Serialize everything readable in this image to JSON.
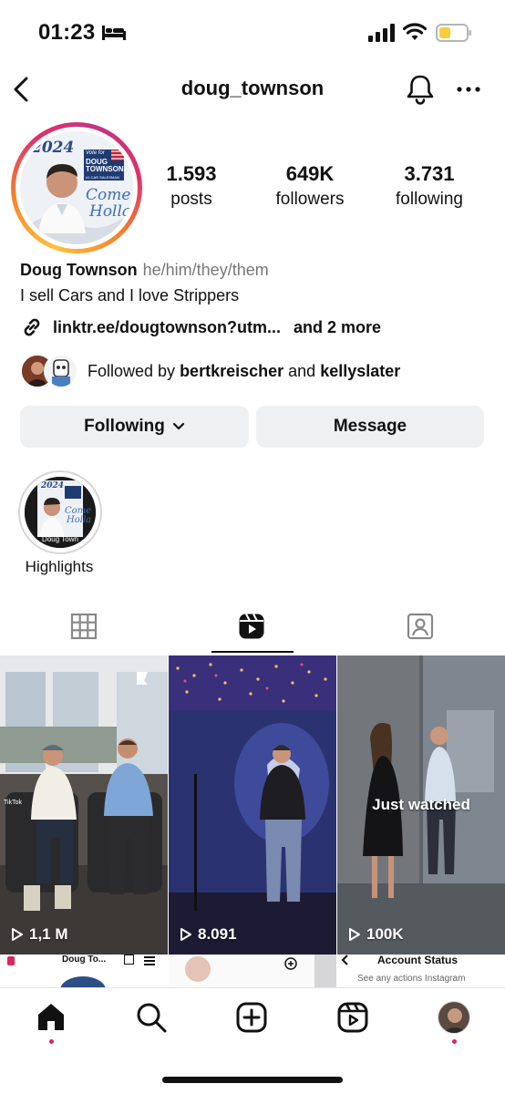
{
  "status_bar": {
    "time": "01:23"
  },
  "header": {
    "username": "doug_townson"
  },
  "avatar": {
    "year": "2024",
    "vote_text": "Vote for",
    "name_line1": "DOUG",
    "name_line2": "TOWNSON",
    "tagline": "#1 CAR SALESMAN",
    "slogan1": "Come",
    "slogan2": "Holla"
  },
  "stats": [
    {
      "number": "1.593",
      "label": "posts"
    },
    {
      "number": "649K",
      "label": "followers"
    },
    {
      "number": "3.731",
      "label": "following"
    }
  ],
  "profile": {
    "display_name": "Doug Townson",
    "pronouns": "he/him/they/them",
    "bio": "I sell Cars and I love Strippers",
    "link": "linktr.ee/dougtownson?utm...",
    "link_more": "and 2 more",
    "followed_by_prefix": "Followed by",
    "follower1": "bertkreischer",
    "and": "and",
    "follower2": "kellyslater"
  },
  "actions": {
    "following_label": "Following",
    "message_label": "Message"
  },
  "highlight": {
    "label": "Highlights",
    "cover_caption": "Doug Town"
  },
  "reels": [
    {
      "views": "1,1 M",
      "overlay": "",
      "watermark": "TikTok"
    },
    {
      "views": "8.091",
      "overlay": ""
    },
    {
      "views": "100K",
      "overlay": "Just watched"
    }
  ],
  "strip": {
    "left_name": "Doug To...",
    "right_title": "Account Status",
    "right_sub": "See any actions Instagram"
  },
  "colors": {
    "accent_red": "#e0245e",
    "button_bg": "#eff0f2",
    "ring_orange": "#f58529",
    "ring_pink": "#e1306c"
  }
}
